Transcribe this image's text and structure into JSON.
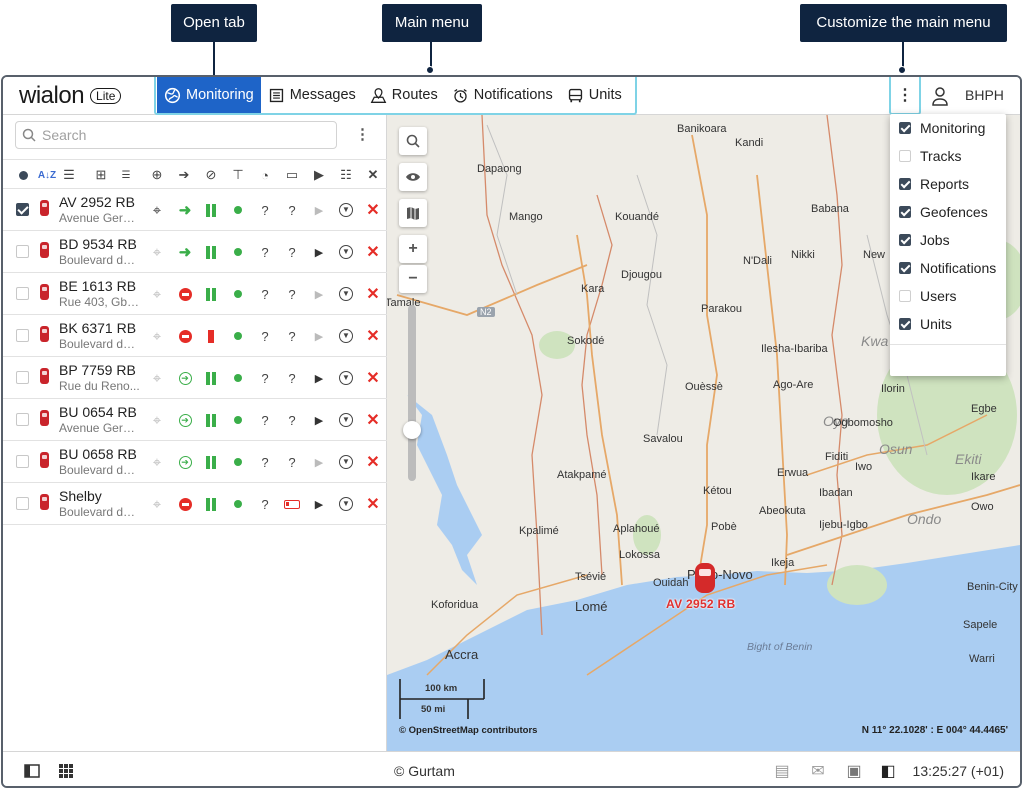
{
  "callouts": {
    "open_tab": "Open tab",
    "main_menu": "Main menu",
    "customize": "Customize the main menu"
  },
  "app": {
    "logo": "wialon",
    "logo_badge": "Lite",
    "user": "BHPH"
  },
  "nav": [
    {
      "label": "Monitoring",
      "icon": "globe-icon",
      "active": true
    },
    {
      "label": "Messages",
      "icon": "messages-icon"
    },
    {
      "label": "Routes",
      "icon": "routes-icon"
    },
    {
      "label": "Notifications",
      "icon": "alarm-clock-icon"
    },
    {
      "label": "Units",
      "icon": "bus-icon"
    }
  ],
  "search": {
    "placeholder": "Search"
  },
  "units": [
    {
      "name": "AV 2952 RB",
      "address": "Avenue Germ...",
      "checked": true,
      "status": "ok",
      "motion": "play-grey"
    },
    {
      "name": "BD 9534 RB",
      "address": "Boulevard de ...",
      "checked": false,
      "status": "ok",
      "motion": "play-dark"
    },
    {
      "name": "BE 1613 RB",
      "address": "Rue 403, Gbe...",
      "checked": false,
      "status": "stop",
      "motion": "play-grey"
    },
    {
      "name": "BK 6371 RB",
      "address": "Boulevard de ...",
      "checked": false,
      "status": "stop",
      "motion": "play-grey"
    },
    {
      "name": "BP 7759 RB",
      "address": "Rue du Reno...",
      "checked": false,
      "status": "arrow",
      "motion": "play-dark"
    },
    {
      "name": "BU 0654 RB",
      "address": "Avenue Germ...",
      "checked": false,
      "status": "arrow",
      "motion": "play-dark"
    },
    {
      "name": "BU 0658 RB",
      "address": "Boulevard de ...",
      "checked": false,
      "status": "arrow",
      "motion": "play-grey"
    },
    {
      "name": "Shelby",
      "address": "Boulevard de ...",
      "checked": false,
      "status": "stop",
      "motion": "play-dark"
    }
  ],
  "cell_unknown": "?",
  "map": {
    "unit_label": "AV 2952 RB",
    "scale_km": "100 km",
    "scale_mi": "50 mi",
    "attribution": "© OpenStreetMap contributors",
    "coords": "N 11° 22.1028' : E 004° 44.4465'",
    "road": "N2",
    "sea": "Bight of Benin",
    "places": [
      "Banikoara",
      "Kandi",
      "Dapaong",
      "Mango",
      "Kouandé",
      "Babana",
      "N'Dali",
      "Nikki",
      "Djougou",
      "Kara",
      "Parakou",
      "Tamale",
      "Sokodé",
      "Ilesha-Ibariba",
      "Ouèssè",
      "Ago-Are",
      "Ilorin",
      "Oyo",
      "Ogbomosho",
      "Egbe",
      "Savalou",
      "Fiditi",
      "Iwo",
      "Osun",
      "Ekiti",
      "Ikare",
      "Erwua",
      "Ibadan",
      "Atakpamé",
      "Kétou",
      "Abeokuta",
      "Ondo",
      "Owo",
      "Pobè",
      "Ijebu-Igbo",
      "Kpalimé",
      "Aplahoué",
      "Lokossa",
      "Porto-Novo",
      "Ikeja",
      "Benin-City",
      "Tsévié",
      "Ouidah",
      "Lomé",
      "Koforidua",
      "Sapele",
      "Accra",
      "Warri",
      "Kwa",
      "New"
    ]
  },
  "dropdown": [
    {
      "label": "Monitoring",
      "checked": true
    },
    {
      "label": "Tracks",
      "checked": false
    },
    {
      "label": "Reports",
      "checked": true
    },
    {
      "label": "Geofences",
      "checked": true
    },
    {
      "label": "Jobs",
      "checked": true
    },
    {
      "label": "Notifications",
      "checked": true
    },
    {
      "label": "Users",
      "checked": false
    },
    {
      "label": "Units",
      "checked": true
    }
  ],
  "footer": {
    "copyright": "© Gurtam",
    "time": "13:25:27 (+01)"
  },
  "colors": {
    "accent": "#1e64c8",
    "callout": "#0f2440",
    "highlight": "#7fd3e6",
    "danger": "#e52d27",
    "ok": "#3aae49",
    "sea": "#aacdf2"
  }
}
